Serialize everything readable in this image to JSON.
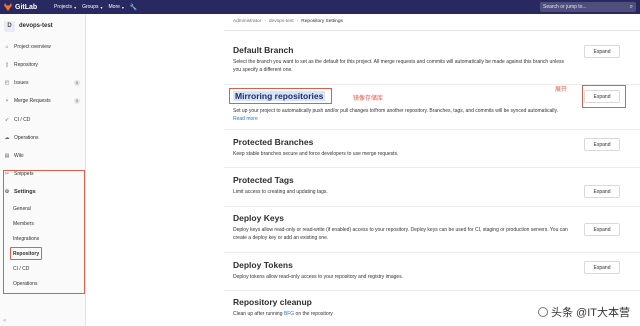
{
  "topbar": {
    "logo": "GitLab",
    "nav": [
      "Projects",
      "Groups",
      "More"
    ],
    "search_placeholder": "Search or jump to..."
  },
  "sidebar": {
    "project_initial": "D",
    "project_name": "devops-test",
    "items": [
      {
        "label": "Project overview"
      },
      {
        "label": "Repository"
      },
      {
        "label": "Issues",
        "count": "0"
      },
      {
        "label": "Merge Requests",
        "count": "0"
      },
      {
        "label": "CI / CD"
      },
      {
        "label": "Operations"
      },
      {
        "label": "Wiki"
      },
      {
        "label": "Snippets"
      }
    ],
    "settings_label": "Settings",
    "settings_sub": [
      "General",
      "Members",
      "Integrations",
      "Repository",
      "CI / CD",
      "Operations"
    ]
  },
  "breadcrumb": [
    "Administrator",
    "devops-test",
    "Repository Settings"
  ],
  "sections": [
    {
      "title": "Default Branch",
      "desc": "Select the branch you want to set as the default for this project. All merge requests and commits will automatically be made against this branch unless you specify a different one.",
      "button": "Expand"
    },
    {
      "title": "Mirroring repositories",
      "desc": "Set up your project to automatically push and/or pull changes to/from another repository. Branches, tags, and commits will be synced automatically.",
      "link": "Read more",
      "button": "Expand"
    },
    {
      "title": "Protected Branches",
      "desc": "Keep stable branches secure and force developers to use merge requests.",
      "button": "Expand"
    },
    {
      "title": "Protected Tags",
      "desc": "Limit access to creating and updating tags.",
      "button": "Expand"
    },
    {
      "title": "Deploy Keys",
      "desc": "Deploy keys allow read-only or read-write (if enabled) access to your repository. Deploy keys can be used for CI, staging or production servers. You can create a deploy key or add an existing one.",
      "button": "Expand"
    },
    {
      "title": "Deploy Tokens",
      "desc": "Deploy tokens allow read-only access to your repository and registry images.",
      "button": "Expand"
    },
    {
      "title": "Repository cleanup",
      "desc_prefix": "Clean up after running",
      "desc_link": "BFG",
      "desc_suffix": "on the repository"
    }
  ],
  "annotations": {
    "mirror": "镜像存储库",
    "expand": "展开"
  },
  "watermark": "头条 @IT大本营",
  "colors": {
    "navbar": "#292961",
    "annotation": "#e25d48",
    "link": "#1f78d1"
  }
}
